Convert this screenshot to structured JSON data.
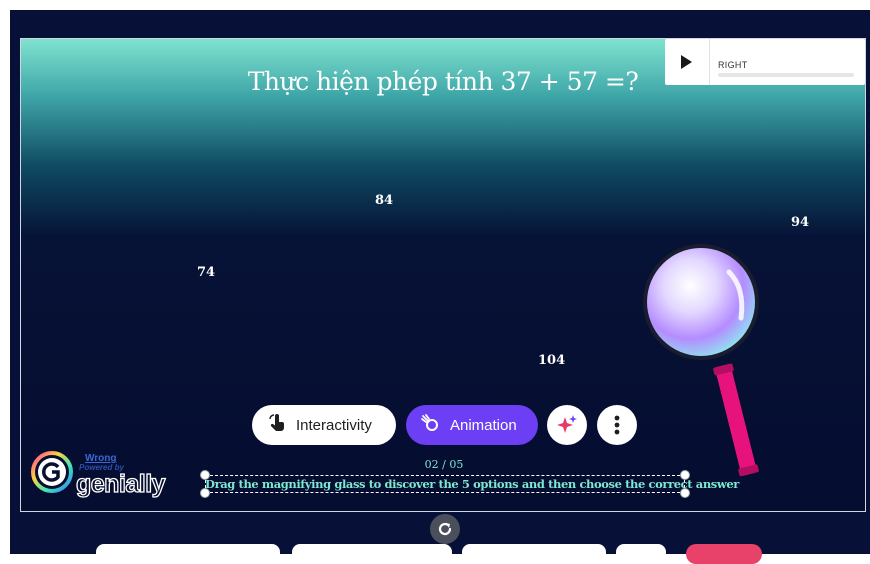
{
  "slide": {
    "title": "Thực hiện phép tính 37 + 57 =?",
    "options": [
      "84",
      "94",
      "74",
      "104"
    ],
    "counter": "02 / 05",
    "instruction": "Drag the magnifying glass to discover the 5 options and then choose the correct answer"
  },
  "audio_player": {
    "play_icon": "play-icon",
    "label": "RIGHT"
  },
  "toolbar": {
    "interactivity_label": "Interactivity",
    "animation_label": "Animation",
    "ai_icon": "sparkle-icon",
    "more_icon": "more-vertical-icon"
  },
  "branding": {
    "wrong_label": "Wrong",
    "powered_by": "Powered by",
    "brand_name": "genially"
  },
  "colors": {
    "accent_purple": "#6c3ef4",
    "teal_text": "#7ee8d1",
    "magnifier_handle": "#e8127d",
    "background": "#071036"
  }
}
